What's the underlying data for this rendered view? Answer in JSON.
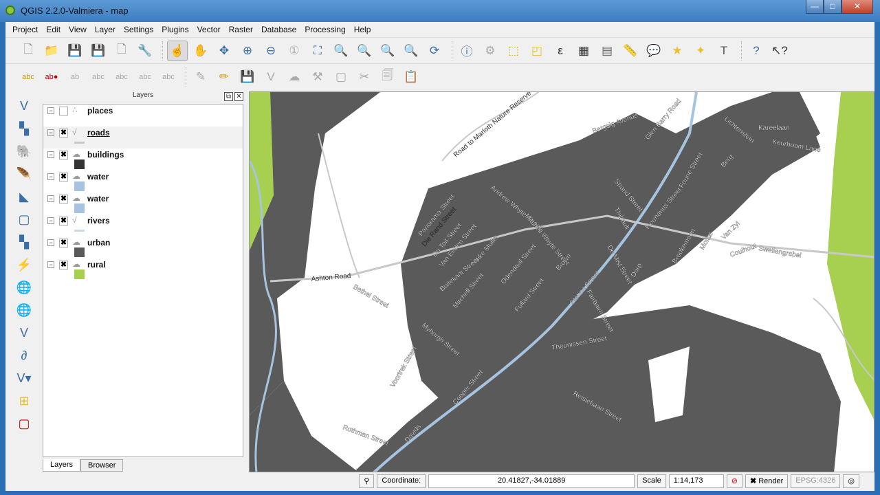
{
  "window": {
    "title": "QGIS 2.2.0-Valmiera - map",
    "minimize": "—",
    "maximize": "□",
    "close": "✕"
  },
  "menu": [
    "Project",
    "Edit",
    "View",
    "Layer",
    "Settings",
    "Plugins",
    "Vector",
    "Raster",
    "Database",
    "Processing",
    "Help"
  ],
  "layers_panel": {
    "title": "Layers",
    "float": "⧉",
    "close": "✕",
    "layers": [
      {
        "name": "places",
        "checked": "",
        "swatch": ""
      },
      {
        "name": "roads",
        "checked": "✖",
        "swatch": "#c8c8c8"
      },
      {
        "name": "buildings",
        "checked": "✖",
        "swatch": "#333333"
      },
      {
        "name": "water",
        "checked": "✖",
        "swatch": "#a6c4e0"
      },
      {
        "name": "water",
        "checked": "✖",
        "swatch": "#a6c4e0"
      },
      {
        "name": "rivers",
        "checked": "✖",
        "swatch": "#c8d8e8"
      },
      {
        "name": "urban",
        "checked": "✖",
        "swatch": "#5a5a5a"
      },
      {
        "name": "rural",
        "checked": "✖",
        "swatch": "#a8d050"
      }
    ],
    "tabs": [
      "Layers",
      "Browser"
    ]
  },
  "map": {
    "labels": [
      "Road to Marloth Nature Reserve",
      "Bergsig Avenue",
      "Glen Barry Road",
      "Lichtenstein",
      "Kareelaan",
      "Keurboom Lane",
      "Andrew Whyte Street",
      "Panorama Street",
      "Die Rand Street",
      "Du Toit Street",
      "Van Eeden Street",
      "Mitchell Whyte Street",
      "Mike Muller",
      "Buitekant Street",
      "Mitchell Street",
      "Odendaal Street",
      "Fullard Street",
      "Brown",
      "Fairbairn Street",
      "Station Street",
      "Thibault",
      "De Mist Street",
      "Dorp",
      "Hermanus Street",
      "Swellengrebel",
      "Ashton Road",
      "Bethel Street",
      "Myburgh Street",
      "Voortrek Street",
      "Cooper Street",
      "Theunissen Street",
      "Reisiebaan Street",
      "Rothman Street",
      "Davids",
      "Moffat",
      "Van Zyl",
      "Coulhout",
      "Brookemoon",
      "Shand Street",
      "Fourie Street",
      "Berg"
    ],
    "colors": {
      "urban": "#5a5a5a",
      "rural": "#a8d050",
      "water": "#a6c4e0",
      "road": "#c8c8c8"
    }
  },
  "status": {
    "coord_label": "Coordinate:",
    "coord_value": "20.41827,-34.01889",
    "scale_label": "Scale",
    "scale_value": "1:14,173",
    "render_label": "Render",
    "render_checked": "✖",
    "epsg": "EPSG:4326"
  }
}
